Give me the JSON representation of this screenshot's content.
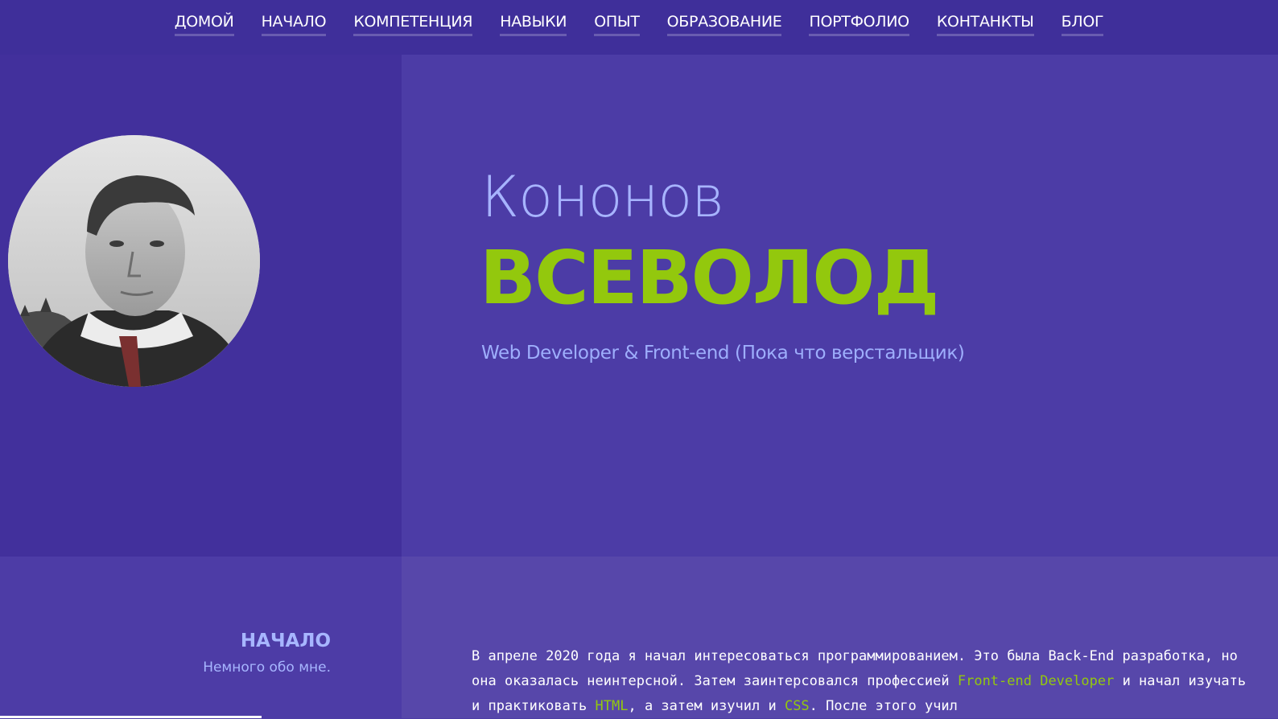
{
  "nav": {
    "items": [
      {
        "label": "ДОМОЙ"
      },
      {
        "label": "НАЧАЛО"
      },
      {
        "label": "КОМПЕТЕНЦИЯ"
      },
      {
        "label": "НАВЫКИ"
      },
      {
        "label": "ОПЫТ"
      },
      {
        "label": "ОБРАЗОВАНИЕ"
      },
      {
        "label": "ПОРТФОЛИО"
      },
      {
        "label": "КОНТАНКТЫ"
      },
      {
        "label": "БЛОГ"
      }
    ]
  },
  "hero": {
    "last_name": "Кононов",
    "first_name": "ВСЕВОЛОД",
    "subtitle": "Web Developer & Front-end (Пока что верстальщик)"
  },
  "about": {
    "title": "НАЧАЛО",
    "subtitle": "Немного обо мне.",
    "text_1": "В апреле 2020 года я начал интересоваться программированием. Это была Back-End разработка, но она оказалась неинтерсной. Затем заинтерсовался профессией ",
    "hl_1": "Front-end Developer",
    "text_2": " и начал изучать и практиковать ",
    "hl_2": "HTML",
    "text_3": ", а затем изучил и ",
    "hl_3": "CSS",
    "text_4": ". После этого учил"
  },
  "colors": {
    "nav_bg": "#3f2f9a",
    "accent_green": "#93c80d",
    "accent_lavender": "#a7b4ff"
  }
}
